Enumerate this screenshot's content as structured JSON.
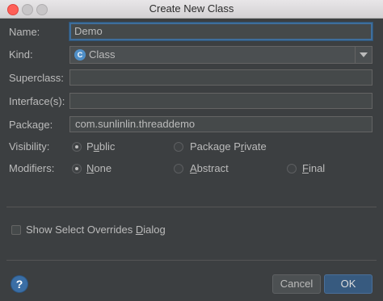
{
  "window": {
    "title": "Create New Class"
  },
  "form": {
    "name_label": "Name:",
    "name_value": "Demo",
    "kind_label": "Kind:",
    "kind_icon_letter": "C",
    "kind_value": "Class",
    "superclass_label": "Superclass:",
    "superclass_value": "",
    "interfaces_label": "Interface(s):",
    "interfaces_value": "",
    "package_label": "Package:",
    "package_value": "com.sunlinlin.threaddemo",
    "visibility_label": "Visibility:",
    "visibility_options": [
      {
        "pre": "P",
        "acc": "u",
        "post": "blic",
        "selected": true
      },
      {
        "pre": "Package P",
        "acc": "r",
        "post": "ivate",
        "selected": false
      }
    ],
    "modifiers_label": "Modifiers:",
    "modifier_options": [
      {
        "pre": "",
        "acc": "N",
        "post": "one",
        "selected": true
      },
      {
        "pre": "",
        "acc": "A",
        "post": "bstract",
        "selected": false
      },
      {
        "pre": "",
        "acc": "F",
        "post": "inal",
        "selected": false
      }
    ],
    "overrides_pre": "Show Select Overrides ",
    "overrides_acc": "D",
    "overrides_post": "ialog",
    "overrides_checked": false
  },
  "footer": {
    "help_glyph": "?",
    "cancel_label": "Cancel",
    "ok_label": "OK"
  },
  "colors": {
    "background": "#3c3f41",
    "accent": "#375a7f",
    "focus_border": "#3e6e9c"
  }
}
